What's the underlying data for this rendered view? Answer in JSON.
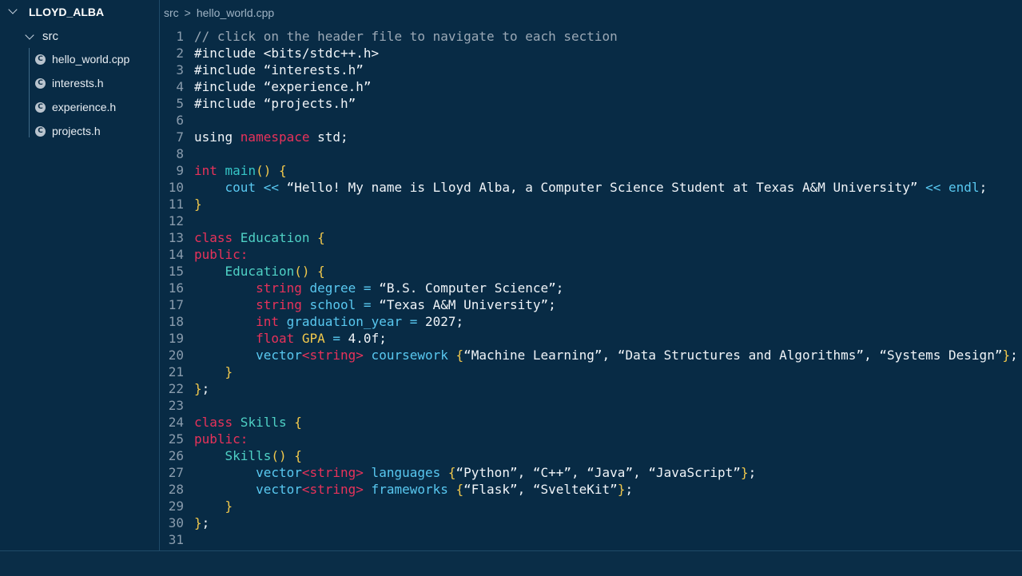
{
  "sidebar": {
    "root_label": "LLOYD_ALBA",
    "folder_label": "src",
    "files": [
      "hello_world.cpp",
      "interests.h",
      "experience.h",
      "projects.h"
    ],
    "file_icon_glyph": "C"
  },
  "breadcrumb": {
    "folder": "src",
    "separator": ">",
    "file": "hello_world.cpp"
  },
  "editor": {
    "line_numbers": [
      "1",
      "2",
      "3",
      "4",
      "5",
      "6",
      "7",
      "8",
      "9",
      "10",
      "11",
      "12",
      "13",
      "14",
      "15",
      "16",
      "17",
      "18",
      "19",
      "20",
      "21",
      "22",
      "23",
      "24",
      "25",
      "26",
      "27",
      "28",
      "29",
      "30",
      "31"
    ],
    "l1": "// click on the header file to navigate to each section",
    "l2": "#include <bits/stdc++.h>",
    "l3": "#include “interests.h”",
    "l4": "#include “experience.h”",
    "l5": "#include “projects.h”",
    "l7a": "using ",
    "l7b": "namespace",
    "l7c": " std;",
    "l9a": "int",
    "l9b": " main",
    "l9c": "() {",
    "l10a": "    cout",
    "l10b": " <<",
    "l10c": " “Hello! My name is Lloyd Alba, a Computer Science Student at Texas A&M University”",
    "l10d": " <<",
    "l10e": " endl",
    "l10f": ";",
    "l11": "}",
    "l13a": "class",
    "l13b": " Education",
    "l13c": " {",
    "l14": "public:",
    "l15a": "    Education",
    "l15b": "() {",
    "l16a": "        string",
    "l16b": " degree",
    "l16c": " =",
    "l16d": " “B.S. Computer Science”;",
    "l17a": "        string",
    "l17b": " school",
    "l17c": " =",
    "l17d": " “Texas A&M University”;",
    "l18a": "        int",
    "l18b": " graduation_year",
    "l18c": " =",
    "l18d": " 2027;",
    "l19a": "        float",
    "l19b": " GPA",
    "l19c": " =",
    "l19d": " 4.0f;",
    "l20a": "        vector",
    "l20b": "<string>",
    "l20c": " coursework",
    "l20d": " {",
    "l20e": "“Machine Learning”, “Data Structures and Algorithms”, “Systems Design”",
    "l20f": "}",
    "l20g": ";",
    "l21": "    }",
    "l22a": "}",
    "l22b": ";",
    "l24a": "class",
    "l24b": " Skills",
    "l24c": " {",
    "l25": "public:",
    "l26a": "    Skills",
    "l26b": "() {",
    "l27a": "        vector",
    "l27b": "<string>",
    "l27c": " languages",
    "l27d": " {",
    "l27e": "“Python”, “C++”, “Java”, “JavaScript”",
    "l27f": "}",
    "l27g": ";",
    "l28a": "        vector",
    "l28b": "<string>",
    "l28c": " frameworks",
    "l28d": " {",
    "l28e": "“Flask”, “SvelteKit”",
    "l28f": "}",
    "l28g": ";",
    "l29": "    }",
    "l30a": "}",
    "l30b": ";"
  },
  "colors": {
    "background": "#082b45",
    "keyword": "#e8325a",
    "class_name": "#4fd1c5",
    "brace": "#f2c94c",
    "variable": "#59c8f0",
    "comment": "#9aa8b5"
  }
}
